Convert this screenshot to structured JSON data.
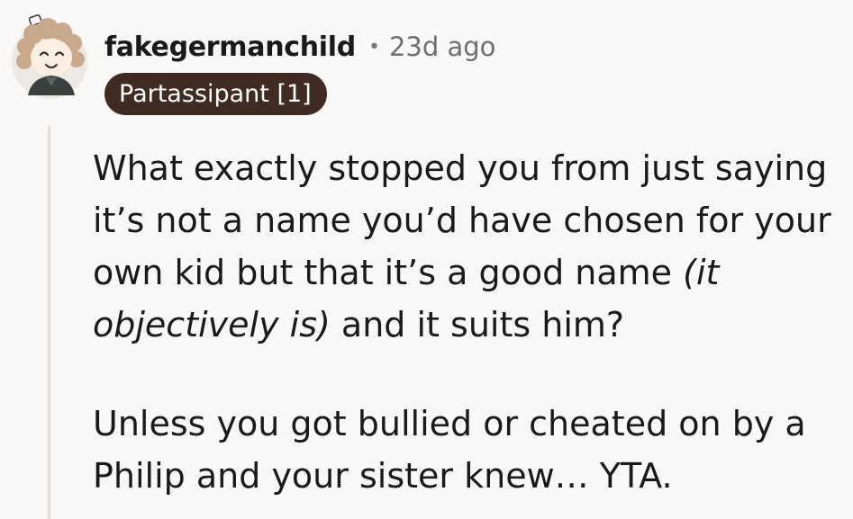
{
  "comment": {
    "author": "fakegermanchild",
    "separator": "•",
    "timestamp": "23d ago",
    "flair": "Partassipant [1]",
    "paragraph_1": {
      "before_italic": "What exactly stopped you from just saying it’s not a name you’d have chosen for your own kid but that it’s a good name ",
      "italic": "(it objectively is)",
      "after_italic": " and it suits him?"
    },
    "paragraph_2": "Unless you got bullied or cheated on by a Philip and your sister knew… YTA."
  },
  "icons": {
    "avatar": "avatar-icon"
  },
  "colors": {
    "background": "#faf8f6",
    "flair_background": "#3f2b22",
    "thread_line": "#e6ddd6",
    "username": "#1a1a1b",
    "timestamp": "#6f6f6f"
  }
}
